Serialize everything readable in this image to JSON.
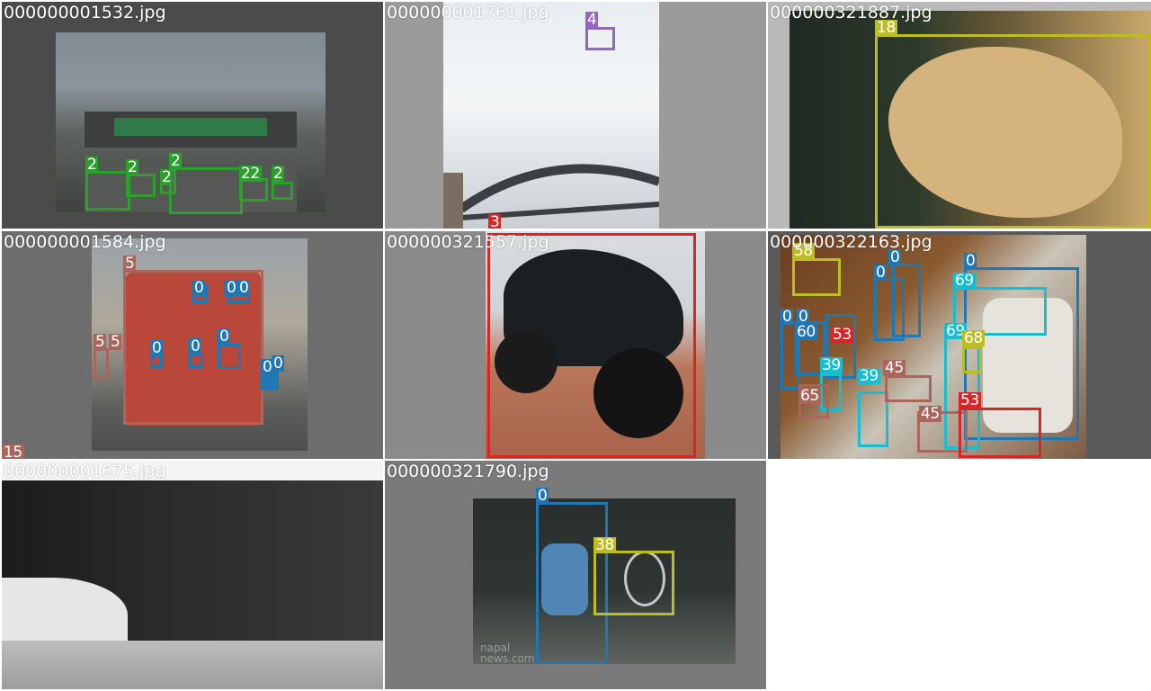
{
  "tiles": [
    {
      "filename": "000000001532.jpg",
      "labels": [
        "2",
        "2",
        "2",
        "2",
        "22",
        "2"
      ]
    },
    {
      "filename": "000000001761.jpg",
      "labels": [
        "4",
        "3"
      ]
    },
    {
      "filename": "000000321887.jpg",
      "labels": [
        "18"
      ]
    },
    {
      "filename": "000000001584.jpg",
      "labels": [
        "5",
        "5",
        "5",
        "0",
        "0",
        "0",
        "0",
        "0",
        "0",
        "0",
        "0",
        "15"
      ]
    },
    {
      "filename": "000000321557.jpg",
      "labels": [
        "3"
      ]
    },
    {
      "filename": "000000322163.jpg",
      "labels": [
        "58",
        "0",
        "0",
        "69",
        "0",
        "0",
        "0",
        "60",
        "53",
        "69",
        "68",
        "39",
        "39",
        "45",
        "65",
        "45",
        "53"
      ]
    },
    {
      "filename": "000000001675.jpg",
      "labels": []
    },
    {
      "filename": "000000321790.jpg",
      "labels": [
        "0",
        "38"
      ],
      "watermark": "napal\nnews.com"
    }
  ],
  "colors": {
    "green": "#2ca02c",
    "purple": "#9467bd",
    "olive": "#bcbd22",
    "brown": "#a9665d",
    "blue": "#1f77b4",
    "cyan": "#17becf",
    "red": "#d62728",
    "pink": "#e377c2",
    "gray": "#8c8c8c"
  }
}
